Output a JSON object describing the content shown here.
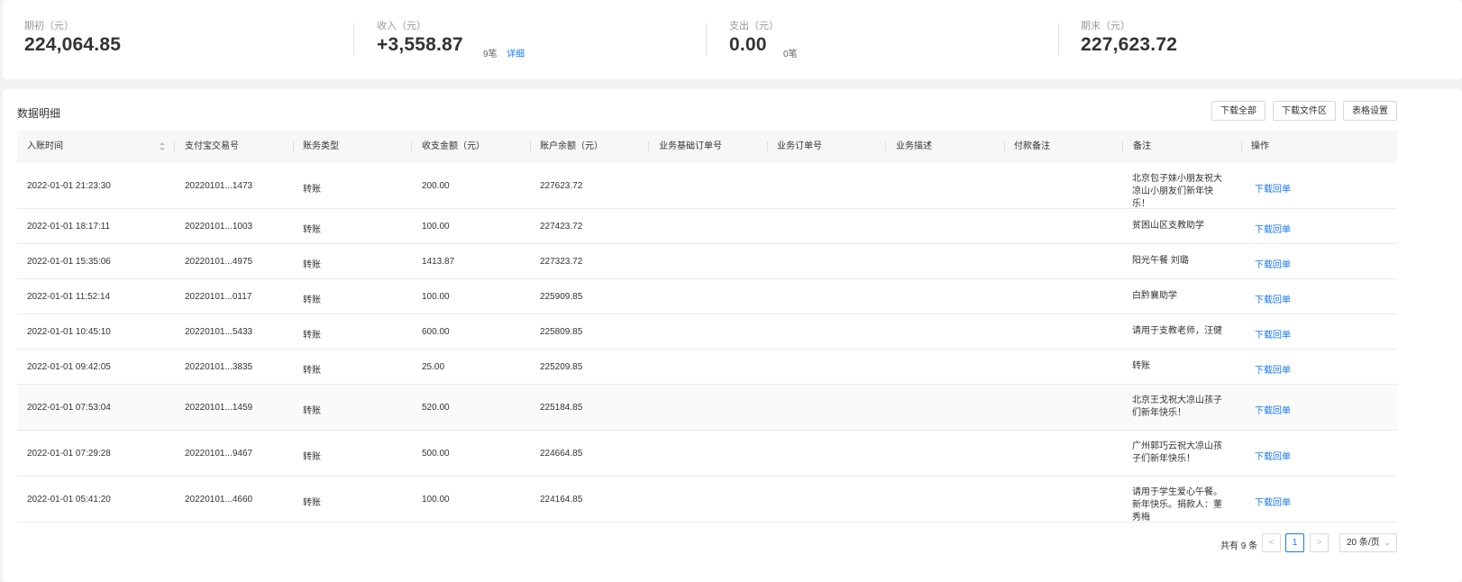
{
  "summary": [
    {
      "label": "期初（元）",
      "value": "224,064.85"
    },
    {
      "label": "收入（元）",
      "value": "+3,558.87",
      "count": "9笔",
      "link": "详细"
    },
    {
      "label": "支出（元）",
      "value": "0.00",
      "count": "0笔"
    },
    {
      "label": "期末（元）",
      "value": "227,623.72"
    }
  ],
  "panel": {
    "title": "数据明细",
    "buttons": [
      "下载全部",
      "下载文件区",
      "表格设置"
    ]
  },
  "table": {
    "columns": [
      "入账时间",
      "支付宝交易号",
      "账务类型",
      "收支金额（元）",
      "账户余额（元）",
      "业务基础订单号",
      "业务订单号",
      "业务描述",
      "付款备注",
      "备注",
      "操作"
    ],
    "rows": [
      {
        "time": "2022-01-01 21:23:30",
        "txn": "20220101...1473",
        "type": "转账",
        "amount": "200.00",
        "balance": "227623.72",
        "note": "北京包子妹小朋友祝大凉山小朋友们新年快乐！",
        "action": "下载回单"
      },
      {
        "time": "2022-01-01 18:17:11",
        "txn": "20220101...1003",
        "type": "转账",
        "amount": "100.00",
        "balance": "227423.72",
        "note": "贫困山区支教助学",
        "action": "下载回单"
      },
      {
        "time": "2022-01-01 15:35:06",
        "txn": "20220101...4975",
        "type": "转账",
        "amount": "1413.87",
        "balance": "227323.72",
        "note": "阳光午餐 刘璐",
        "action": "下载回单"
      },
      {
        "time": "2022-01-01 11:52:14",
        "txn": "20220101...0117",
        "type": "转账",
        "amount": "100.00",
        "balance": "225909.85",
        "note": "白黔襄助学",
        "action": "下载回单"
      },
      {
        "time": "2022-01-01 10:45:10",
        "txn": "20220101...5433",
        "type": "转账",
        "amount": "600.00",
        "balance": "225809.85",
        "note": "请用于支教老师，汪健",
        "action": "下载回单"
      },
      {
        "time": "2022-01-01 09:42:05",
        "txn": "20220101...3835",
        "type": "转账",
        "amount": "25.00",
        "balance": "225209.85",
        "note": "转账",
        "action": "下载回单"
      },
      {
        "time": "2022-01-01 07:53:04",
        "txn": "20220101...1459",
        "type": "转账",
        "amount": "520.00",
        "balance": "225184.85",
        "note": "北京王戈祝大凉山孩子们新年快乐！",
        "action": "下载回单"
      },
      {
        "time": "2022-01-01 07:29:28",
        "txn": "20220101...9467",
        "type": "转账",
        "amount": "500.00",
        "balance": "224664.85",
        "note": "广州郭巧云祝大凉山孩子们新年快乐！",
        "action": "下载回单"
      },
      {
        "time": "2022-01-01 05:41:20",
        "txn": "20220101...4660",
        "type": "转账",
        "amount": "100.00",
        "balance": "224164.85",
        "note": "请用于学生爱心午餐。新年快乐。捐款人：董秀梅",
        "action": "下载回单"
      }
    ]
  },
  "pagination": {
    "total": "共有 9 条",
    "prev": "<",
    "page": "1",
    "next": ">",
    "page_size": "20 条/页"
  },
  "colors": {
    "link": "#1677ff",
    "border": "#d9d9d9"
  },
  "icons": {
    "sort": "sort-icon",
    "prev": "chevron-left-icon",
    "next": "chevron-right-icon",
    "dropdown": "chevron-down-icon"
  }
}
